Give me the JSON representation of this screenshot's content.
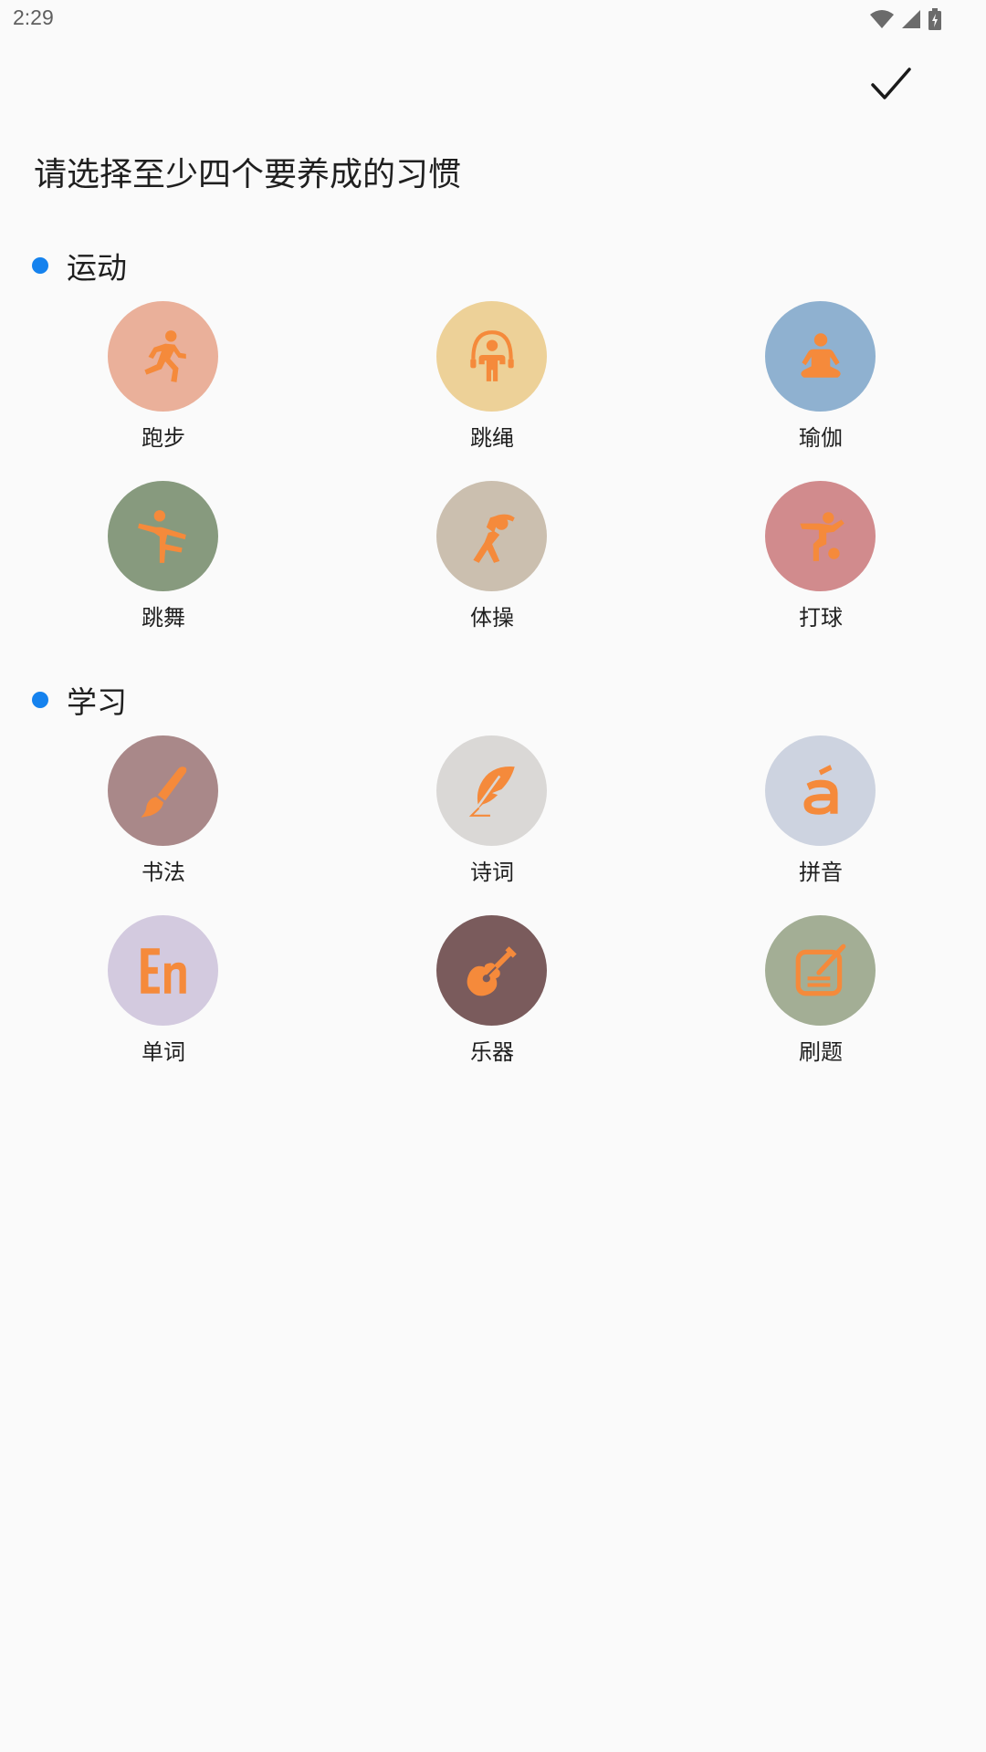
{
  "status_bar": {
    "time": "2:29"
  },
  "header": {
    "confirm_icon": "checkmark-icon",
    "title": "请选择至少四个要养成的习惯"
  },
  "colors": {
    "accent": "#1582ee",
    "icon": "#f58a3b"
  },
  "sections": [
    {
      "label": "运动",
      "habits": [
        {
          "label": "跑步",
          "icon": "running-icon",
          "color": "#eab09a"
        },
        {
          "label": "跳绳",
          "icon": "jump-rope-icon",
          "color": "#edd198"
        },
        {
          "label": "瑜伽",
          "icon": "yoga-icon",
          "color": "#8fb1d0"
        },
        {
          "label": "跳舞",
          "icon": "dance-icon",
          "color": "#879a7e"
        },
        {
          "label": "体操",
          "icon": "gymnastics-icon",
          "color": "#cbbfaf"
        },
        {
          "label": "打球",
          "icon": "soccer-icon",
          "color": "#d18b8d"
        }
      ]
    },
    {
      "label": "学习",
      "habits": [
        {
          "label": "书法",
          "icon": "brush-icon",
          "color": "#a98889"
        },
        {
          "label": "诗词",
          "icon": "feather-icon",
          "color": "#dad8d6"
        },
        {
          "label": "拼音",
          "icon": "pinyin-a-icon",
          "color": "#cdd3e0"
        },
        {
          "label": "单词",
          "icon": "english-word-icon",
          "color": "#d3cadf"
        },
        {
          "label": "乐器",
          "icon": "guitar-icon",
          "color": "#7a5b5c"
        },
        {
          "label": "刷题",
          "icon": "exercise-icon",
          "color": "#a3ae95"
        }
      ]
    }
  ]
}
